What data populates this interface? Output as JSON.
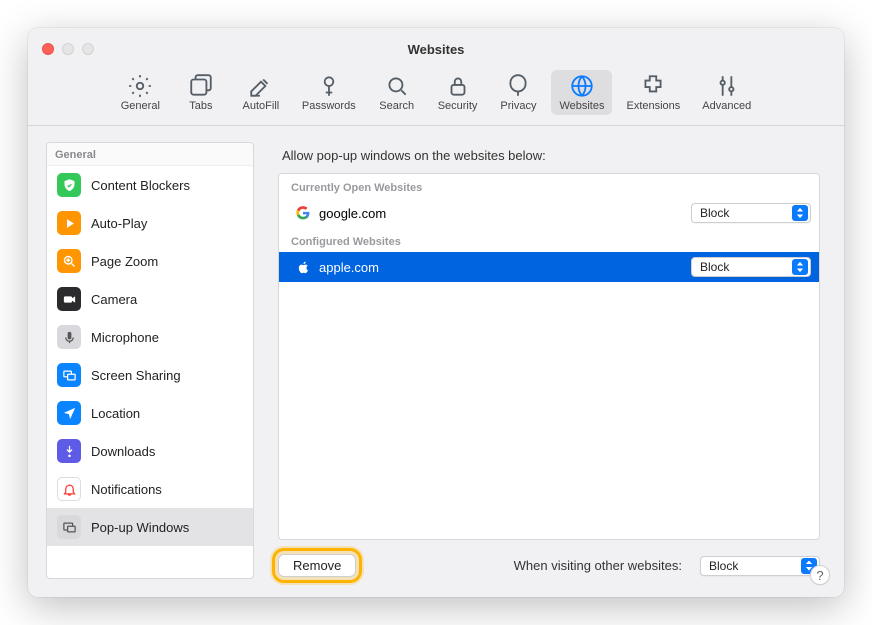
{
  "window": {
    "title": "Websites"
  },
  "toolbar": [
    {
      "name": "general",
      "label": "General",
      "selected": false
    },
    {
      "name": "tabs",
      "label": "Tabs",
      "selected": false
    },
    {
      "name": "autofill",
      "label": "AutoFill",
      "selected": false
    },
    {
      "name": "passwords",
      "label": "Passwords",
      "selected": false
    },
    {
      "name": "search",
      "label": "Search",
      "selected": false
    },
    {
      "name": "security",
      "label": "Security",
      "selected": false
    },
    {
      "name": "privacy",
      "label": "Privacy",
      "selected": false
    },
    {
      "name": "websites",
      "label": "Websites",
      "selected": true
    },
    {
      "name": "extensions",
      "label": "Extensions",
      "selected": false
    },
    {
      "name": "advanced",
      "label": "Advanced",
      "selected": false
    }
  ],
  "sidebar": {
    "header": "General",
    "items": [
      {
        "name": "content-blockers",
        "label": "Content Blockers",
        "color": "#34c759",
        "icon": "shield"
      },
      {
        "name": "auto-play",
        "label": "Auto-Play",
        "color": "#ff9500",
        "icon": "play"
      },
      {
        "name": "page-zoom",
        "label": "Page Zoom",
        "color": "#ff9500",
        "icon": "zoom"
      },
      {
        "name": "camera",
        "label": "Camera",
        "color": "#2b2b2d",
        "icon": "camera"
      },
      {
        "name": "microphone",
        "label": "Microphone",
        "color": "#d9d9dd",
        "icon": "mic"
      },
      {
        "name": "screen-sharing",
        "label": "Screen Sharing",
        "color": "#0a84ff",
        "icon": "screens"
      },
      {
        "name": "location",
        "label": "Location",
        "color": "#0a84ff",
        "icon": "location"
      },
      {
        "name": "downloads",
        "label": "Downloads",
        "color": "#5e5ce6",
        "icon": "download"
      },
      {
        "name": "notifications",
        "label": "Notifications",
        "color": "#ffffff",
        "icon": "bell"
      },
      {
        "name": "popup-windows",
        "label": "Pop-up Windows",
        "color": "#d9d9dd",
        "icon": "popup",
        "selected": true
      }
    ]
  },
  "main": {
    "heading": "Allow pop-up windows on the websites below:",
    "sections": {
      "open_header": "Currently Open Websites",
      "configured_header": "Configured Websites"
    },
    "open_sites": [
      {
        "name": "google.com",
        "favicon": "google",
        "policy": "Block",
        "selected": false
      }
    ],
    "configured_sites": [
      {
        "name": "apple.com",
        "favicon": "apple",
        "policy": "Block",
        "selected": true
      }
    ],
    "remove_label": "Remove",
    "other_label": "When visiting other websites:",
    "other_policy": "Block"
  },
  "help": "?"
}
